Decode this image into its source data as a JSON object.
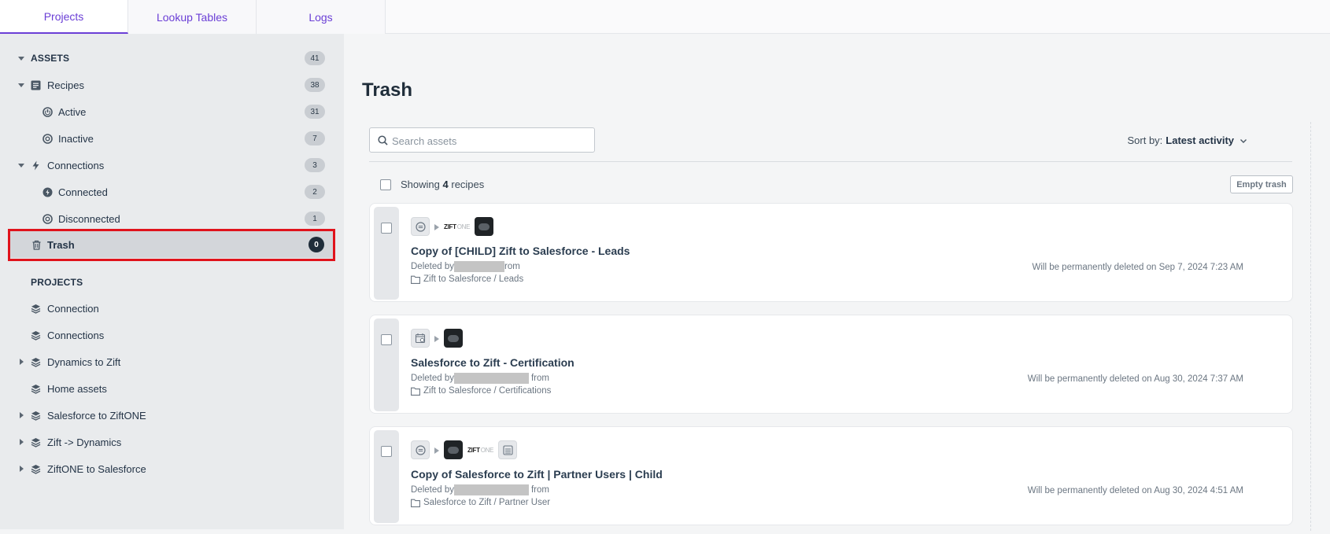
{
  "tabs": [
    {
      "label": "Projects",
      "active": true
    },
    {
      "label": "Lookup Tables",
      "active": false
    },
    {
      "label": "Logs",
      "active": false
    }
  ],
  "sidebar": {
    "assets": {
      "label": "ASSETS",
      "count": "41"
    },
    "recipes": {
      "label": "Recipes",
      "count": "38"
    },
    "active": {
      "label": "Active",
      "count": "31"
    },
    "inactive": {
      "label": "Inactive",
      "count": "7"
    },
    "connections": {
      "label": "Connections",
      "count": "3"
    },
    "connected": {
      "label": "Connected",
      "count": "2"
    },
    "disconnected": {
      "label": "Disconnected",
      "count": "1"
    },
    "trash": {
      "label": "Trash",
      "count": "0"
    },
    "projects_heading": "PROJECTS",
    "projects": [
      {
        "label": "Connection",
        "expandable": false
      },
      {
        "label": "Connections",
        "expandable": false
      },
      {
        "label": "Dynamics to Zift",
        "expandable": true
      },
      {
        "label": "Home assets",
        "expandable": false
      },
      {
        "label": "Salesforce to ZiftONE",
        "expandable": true
      },
      {
        "label": "Zift -> Dynamics",
        "expandable": true
      },
      {
        "label": "ZiftONE to Salesforce",
        "expandable": true
      }
    ]
  },
  "main": {
    "title": "Trash",
    "search_placeholder": "Search assets",
    "sort_prefix": "Sort by:",
    "sort_value": "Latest activity",
    "showing_prefix": "Showing",
    "showing_count": "4",
    "showing_suffix": "recipes",
    "empty_trash_label": "Empty trash",
    "zift_logo_text": "ZIFT",
    "zift_logo_suffix": "ONE",
    "recipes": [
      {
        "title": "Copy of [CHILD] Zift to Salesforce - Leads",
        "deleted_prefix": "Deleted by",
        "deleted_suffix": "rom",
        "folder": "Zift to Salesforce / Leads",
        "permanent": "Will be permanently deleted on Sep 7, 2024 7:23 AM"
      },
      {
        "title": "Salesforce to Zift - Certification",
        "deleted_prefix": "Deleted by",
        "deleted_suffix": "from",
        "folder": "Zift to Salesforce / Certifications",
        "permanent": "Will be permanently deleted on Aug 30, 2024 7:37 AM"
      },
      {
        "title": "Copy of Salesforce to Zift | Partner Users | Child",
        "deleted_prefix": "Deleted by",
        "deleted_suffix": "from",
        "folder": "Salesforce to Zift / Partner User",
        "permanent": "Will be permanently deleted on Aug 30, 2024 4:51 AM"
      }
    ]
  },
  "colors": {
    "accent": "#6b3fd6",
    "highlight": "#e0131c",
    "sidebar_bg": "#e9ebed"
  }
}
